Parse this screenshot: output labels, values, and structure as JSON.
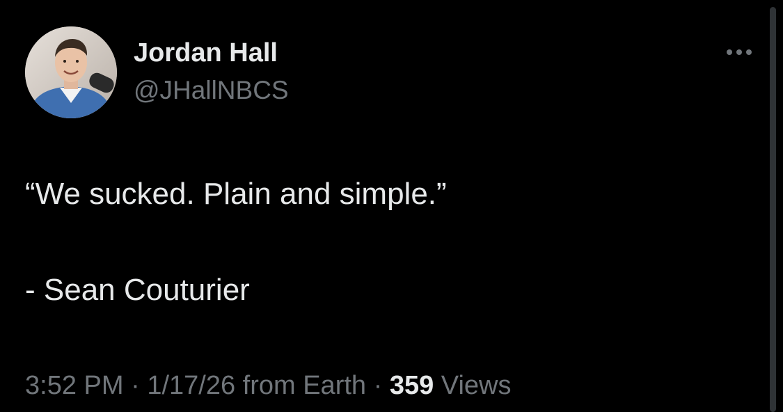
{
  "author": {
    "display_name": "Jordan Hall",
    "handle": "@JHallNBCS",
    "avatar_icon": "profile-photo"
  },
  "menu": {
    "more_icon": "more-horizontal-icon"
  },
  "tweet": {
    "quote": "“We sucked. Plain and simple.”",
    "attribution": "- Sean Couturier"
  },
  "meta": {
    "time": "3:52 PM",
    "separator": " · ",
    "date_source": "1/17/26 from Earth",
    "views_count": "359",
    "views_label": "Views"
  },
  "colors": {
    "background": "#000000",
    "primary_text": "#e7e9ea",
    "secondary_text": "#71767b"
  }
}
